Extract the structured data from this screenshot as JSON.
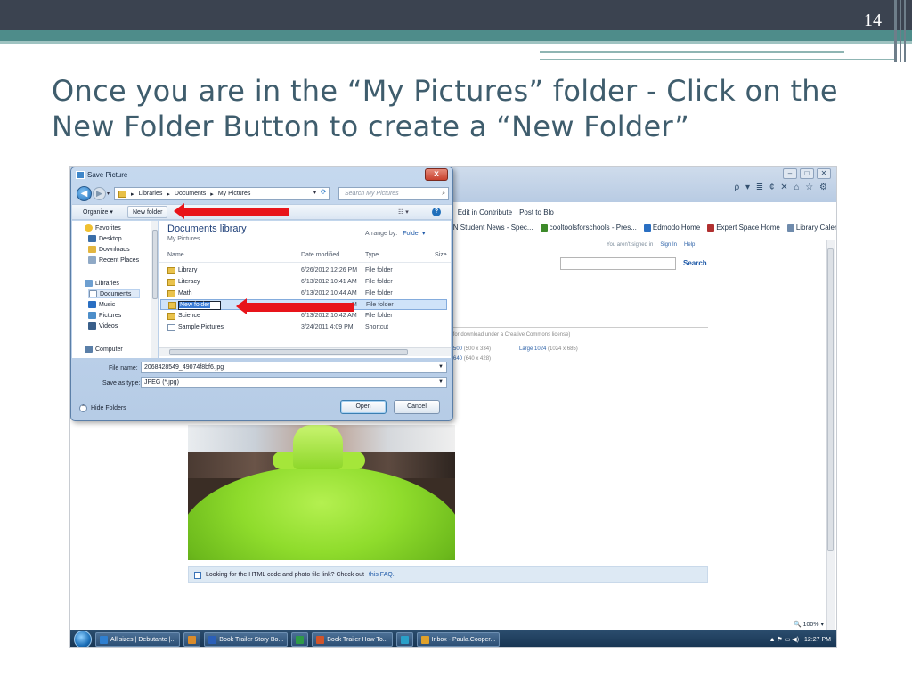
{
  "slide": {
    "number": "14",
    "title": "Once you are in the “My Pictures” folder - Click on the New Folder Button to create a “New Folder”"
  },
  "browser": {
    "addr_tools": "ρ ▾ ≣ ¢ ✕   ⌂ ☆ ⚙",
    "command_bar": [
      "✕",
      "Edit in Contribute",
      "Post to Blo"
    ],
    "favorites": [
      {
        "label": "NN Student News - Spec...",
        "color": "#ffffff"
      },
      {
        "label": "cooltoolsforschools - Pres...",
        "color": "#3d8a2a"
      },
      {
        "label": "Edmodo Home",
        "color": "#2a6fc2"
      },
      {
        "label": "Expert Space Home",
        "color": "#b03030"
      },
      {
        "label": "Library Calendar",
        "color": "#6f8bac"
      }
    ],
    "not_signed_in": "You aren't signed in",
    "sign_in": "Sign In",
    "help": "Help",
    "search_button": "Search",
    "license_text": "ble for download under a Creative Commons license)",
    "size_500": "500",
    "size_500_dim": "(500 x 334)",
    "size_large": "Large 1024",
    "size_large_dim": "(1024 x 685)",
    "size_640": "640",
    "size_640_dim": "(640 x 428)",
    "faq_text": "Looking for the HTML code and photo file link? Check out",
    "faq_link": "this FAQ.",
    "zoom": "100%"
  },
  "taskbar": {
    "items": [
      {
        "label": "All sizes | Debutante |...",
        "color": "#2f7fd0"
      },
      {
        "label": "",
        "color": "#d98b2b"
      },
      {
        "label": "Book Trailer Story Bo...",
        "color": "#2b5fb8"
      },
      {
        "label": "",
        "color": "#2f9a48"
      },
      {
        "label": "Book Trailer How To...",
        "color": "#d0542b"
      },
      {
        "label": "",
        "color": "#2aa0c8"
      },
      {
        "label": "Inbox - Paula.Cooper...",
        "color": "#e0a12a"
      }
    ],
    "time": "12:27 PM"
  },
  "dialog": {
    "title": "Save Picture",
    "close": "x",
    "breadcrumb": [
      "Libraries",
      "Documents",
      "My Pictures"
    ],
    "search_placeholder": "Search My Pictures",
    "toolbar": {
      "organize": "Organize ▾",
      "new_folder": "New folder",
      "views": "☷ ▾",
      "help": "?"
    },
    "nav": {
      "favorites": "Favorites",
      "desktop": "Desktop",
      "downloads": "Downloads",
      "recent_places": "Recent Places",
      "libraries": "Libraries",
      "documents": "Documents",
      "music": "Music",
      "pictures": "Pictures",
      "videos": "Videos",
      "computer": "Computer"
    },
    "library_title": "Documents library",
    "library_sub": "My Pictures",
    "arrange_label": "Arrange by:",
    "arrange_value": "Folder ▾",
    "columns": {
      "name": "Name",
      "date": "Date modified",
      "type": "Type",
      "size": "Size"
    },
    "files": [
      {
        "name": "Library",
        "date": "6/26/2012 12:26 PM",
        "type": "File folder"
      },
      {
        "name": "Literacy",
        "date": "6/13/2012 10:41 AM",
        "type": "File folder"
      },
      {
        "name": "Math",
        "date": "6/13/2012 10:44 AM",
        "type": "File folder"
      },
      {
        "name": "New folder",
        "date": "M",
        "type": "File folder"
      },
      {
        "name": "Science",
        "date": "6/13/2012 10:42 AM",
        "type": "File folder"
      },
      {
        "name": "Sample Pictures",
        "date": "3/24/2011 4:09 PM",
        "type": "Shortcut"
      }
    ],
    "file_name_label": "File name:",
    "file_name_value": "2068428549_49074f8bf6.jpg",
    "save_type_label": "Save as type:",
    "save_type_value": "JPEG (*.jpg)",
    "hide_folders": "Hide Folders",
    "open_button": "Open",
    "cancel_button": "Cancel"
  }
}
